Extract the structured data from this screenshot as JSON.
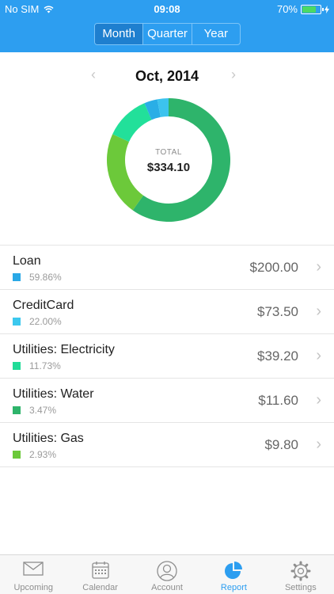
{
  "status_bar": {
    "carrier": "No SIM",
    "time": "09:08",
    "battery": "70%"
  },
  "segments": [
    {
      "label": "Month",
      "active": true
    },
    {
      "label": "Quarter",
      "active": false
    },
    {
      "label": "Year",
      "active": false
    }
  ],
  "period": {
    "title": "Oct, 2014",
    "prev": "‹",
    "next": "›"
  },
  "total": {
    "label": "TOTAL",
    "value": "$334.10"
  },
  "chart_data": {
    "type": "pie",
    "categories": [
      "Loan",
      "CreditCard",
      "Utilities: Electricity",
      "Utilities: Water",
      "Utilities: Gas"
    ],
    "values": [
      59.86,
      22.0,
      11.73,
      3.47,
      2.93
    ],
    "colors": [
      "#2eb46b",
      "#6cc93a",
      "#22e09a",
      "#2aaee6",
      "#3cc3ee"
    ]
  },
  "expenses": [
    {
      "name": "Loan",
      "pct": "59.86%",
      "amount": "$200.00",
      "color": "#2aa8e6"
    },
    {
      "name": "CreditCard",
      "pct": "22.00%",
      "amount": "$73.50",
      "color": "#3cc8ee"
    },
    {
      "name": "Utilities: Electricity",
      "pct": "11.73%",
      "amount": "$39.20",
      "color": "#21dc98"
    },
    {
      "name": "Utilities: Water",
      "pct": "3.47%",
      "amount": "$11.60",
      "color": "#2eb46b"
    },
    {
      "name": "Utilities: Gas",
      "pct": "2.93%",
      "amount": "$9.80",
      "color": "#6cc93a"
    }
  ],
  "tabs": [
    {
      "label": "Upcoming",
      "icon": "envelope-icon"
    },
    {
      "label": "Calendar",
      "icon": "calendar-icon"
    },
    {
      "label": "Account",
      "icon": "account-icon"
    },
    {
      "label": "Report",
      "icon": "report-pie-icon",
      "active": true
    },
    {
      "label": "Settings",
      "icon": "gear-icon"
    }
  ],
  "chevron": "›"
}
